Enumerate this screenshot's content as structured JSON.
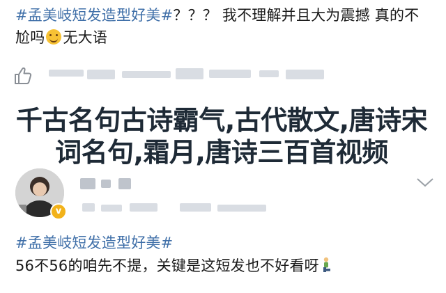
{
  "post1": {
    "hashtag": "#孟美岐短发造型好美#",
    "text_a": "？？？ 我不理解并且大为震撼 真的不尬吗",
    "text_b": "无大语",
    "emoji": "smiling-face-icon"
  },
  "overlay_title": "千古名句古诗霸气,古代散文,唐诗宋词名句,霜月,唐诗三百首视频",
  "post2": {
    "hashtag": "#孟美岐短发造型好美#",
    "text": "56不56的咱先不提，关键是这短发也不好看呀",
    "emoji": "person-kneeling-icon"
  },
  "colors": {
    "hashtag": "#3f6fa8",
    "placeholder_bar": "#d9dde3",
    "badge": "#f2b21a"
  }
}
